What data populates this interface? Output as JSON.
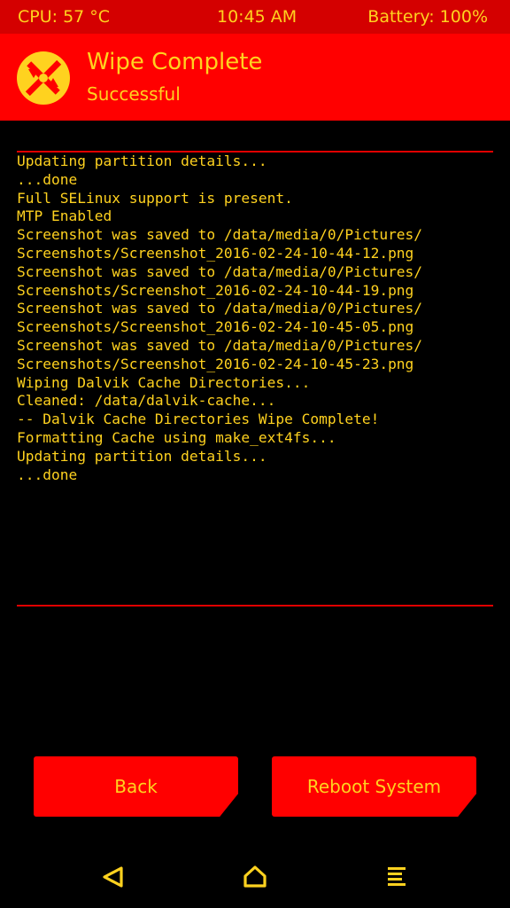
{
  "status_bar": {
    "cpu": "CPU: 57 °C",
    "time": "10:45 AM",
    "battery": "Battery: 100%"
  },
  "header": {
    "title": "Wipe Complete",
    "subtitle": "Successful",
    "logo_icon": "twrp-logo-icon"
  },
  "console": {
    "lines": [
      "Updating partition details...",
      "...done",
      "Full SELinux support is present.",
      "MTP Enabled",
      "Screenshot was saved to /data/media/0/Pictures/",
      "Screenshots/Screenshot_2016-02-24-10-44-12.png",
      "Screenshot was saved to /data/media/0/Pictures/",
      "Screenshots/Screenshot_2016-02-24-10-44-19.png",
      "Screenshot was saved to /data/media/0/Pictures/",
      "Screenshots/Screenshot_2016-02-24-10-45-05.png",
      "Screenshot was saved to /data/media/0/Pictures/",
      "Screenshots/Screenshot_2016-02-24-10-45-23.png",
      "Wiping Dalvik Cache Directories...",
      "Cleaned: /data/dalvik-cache...",
      "-- Dalvik Cache Directories Wipe Complete!",
      "Formatting Cache using make_ext4fs...",
      "Updating partition details...",
      "...done"
    ]
  },
  "buttons": {
    "back": "Back",
    "reboot": "Reboot System"
  },
  "nav": {
    "back_icon": "back-triangle-icon",
    "home_icon": "home-icon",
    "menu_icon": "menu-icon"
  },
  "colors": {
    "accent": "#ff0000",
    "statusbar": "#d40000",
    "text": "#ffd21f",
    "background": "#000000"
  }
}
